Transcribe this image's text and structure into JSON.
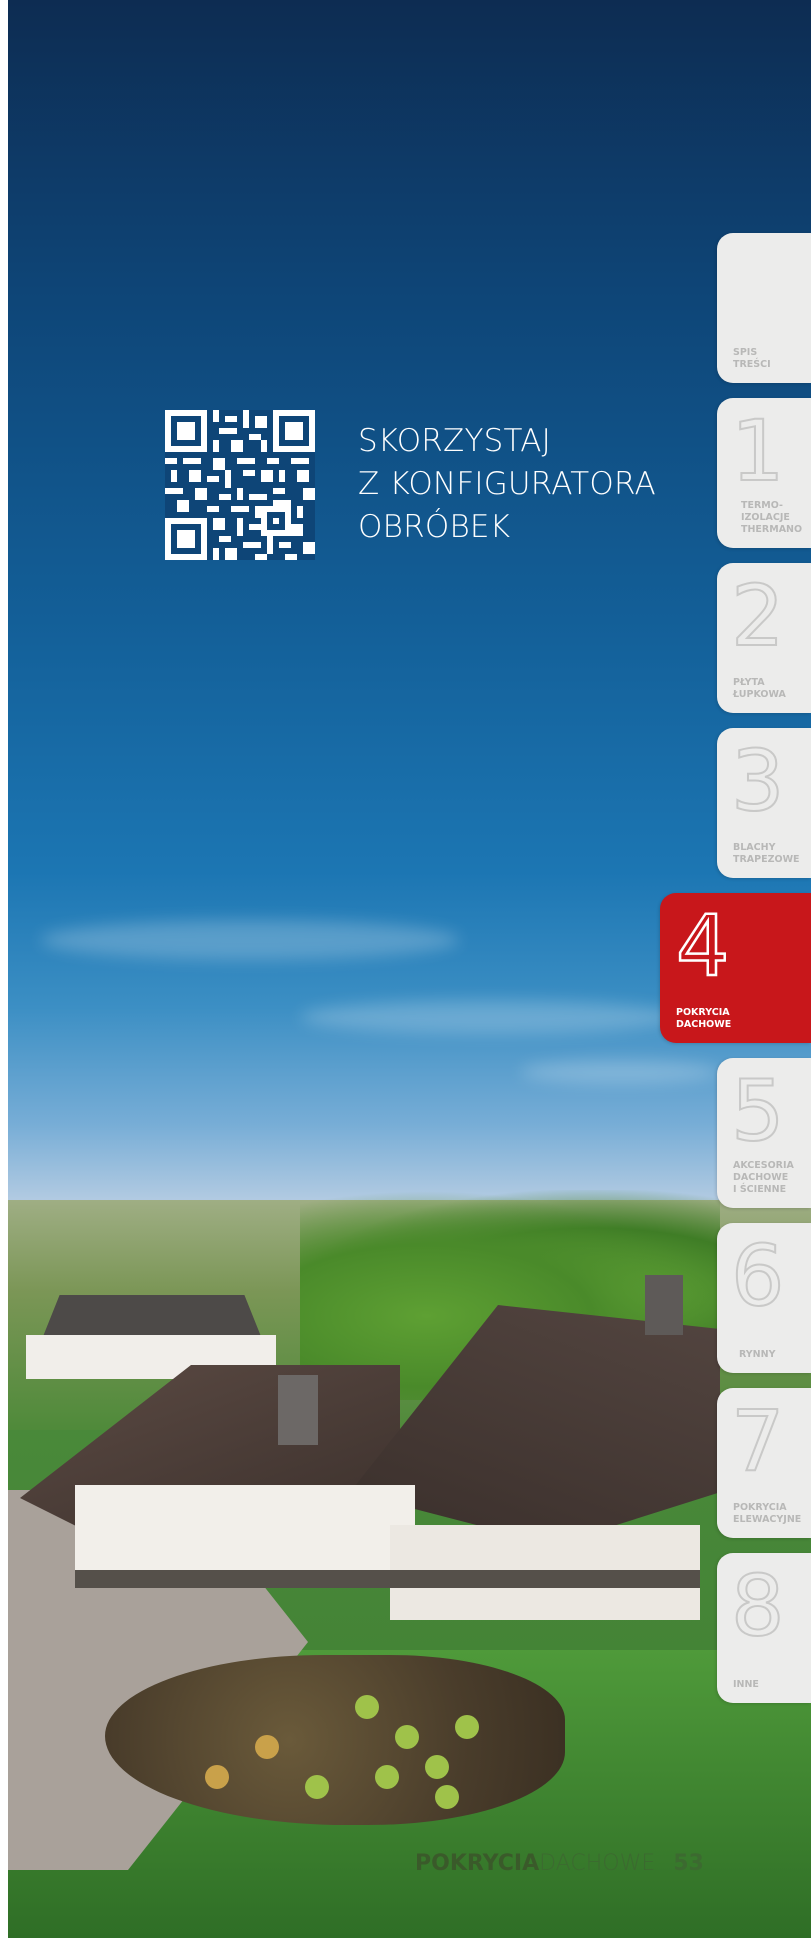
{
  "cta": {
    "lines": [
      "SKORZYSTAJ",
      "Z KONFIGURATORA",
      "OBRÓBEK"
    ]
  },
  "tabs": [
    {
      "number": "",
      "label_lines": [
        "SPIS",
        "TREŚCI"
      ],
      "active": false
    },
    {
      "number": "1",
      "label_lines": [
        "TERMO-",
        "IZOLACJE",
        "THERMANO"
      ],
      "active": false
    },
    {
      "number": "2",
      "label_lines": [
        "PŁYTA",
        "ŁUPKOWA"
      ],
      "active": false
    },
    {
      "number": "3",
      "label_lines": [
        "BLACHY",
        "TRAPEZOWE"
      ],
      "active": false
    },
    {
      "number": "4",
      "label_lines": [
        "POKRYCIA",
        "DACHOWE"
      ],
      "active": true
    },
    {
      "number": "5",
      "label_lines": [
        "AKCESORIA",
        "DACHOWE",
        "I ŚCIENNE"
      ],
      "active": false
    },
    {
      "number": "6",
      "label_lines": [
        "RYNNY"
      ],
      "active": false
    },
    {
      "number": "7",
      "label_lines": [
        "POKRYCIA",
        "ELEWACYJNE"
      ],
      "active": false
    },
    {
      "number": "8",
      "label_lines": [
        "INNE"
      ],
      "active": false
    }
  ],
  "footer": {
    "section_bold": "POKRYCIA",
    "section_light": "DACHOWE",
    "page_number": "53"
  },
  "colors": {
    "active_tab": "#c8171b",
    "tab_bg": "#ececeb",
    "tab_text": "#b8b8b7"
  }
}
